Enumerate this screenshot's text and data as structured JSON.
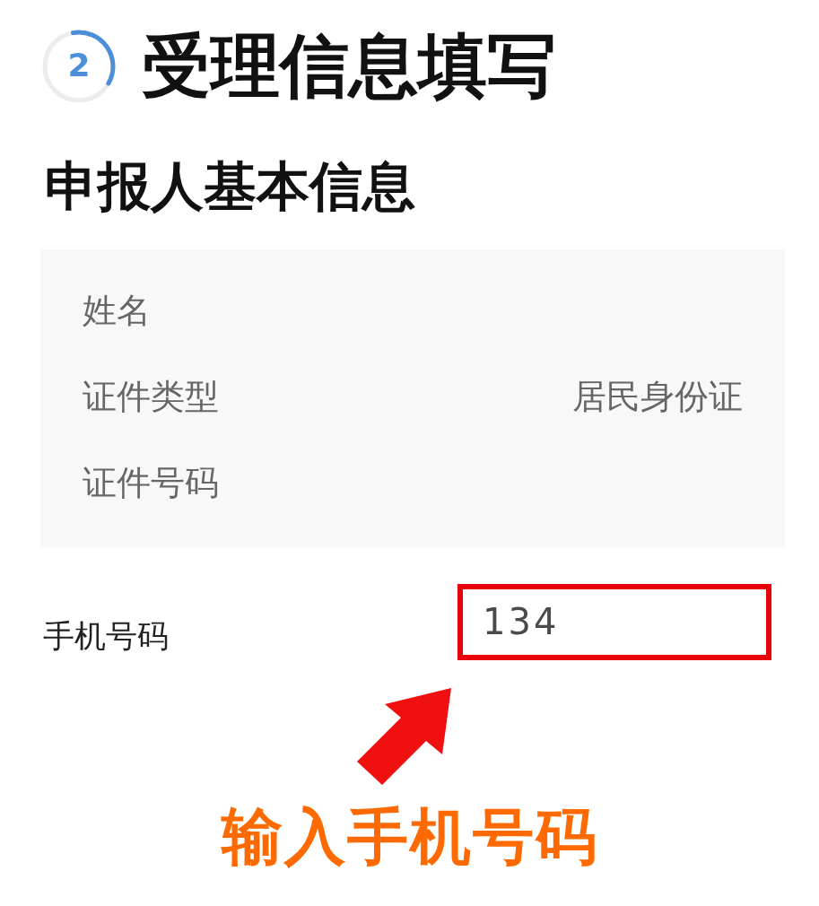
{
  "step": {
    "number": "2",
    "title": "受理信息填写"
  },
  "section": {
    "title": "申报人基本信息"
  },
  "panel": {
    "rows": [
      {
        "label": "姓名"
      },
      {
        "label": "证件类型",
        "value": "居民身份证"
      },
      {
        "label": "证件号码"
      }
    ]
  },
  "phone": {
    "label": "手机号码",
    "value": "134",
    "highlighted": true
  },
  "annotation": {
    "caption": "输入手机号码"
  }
}
